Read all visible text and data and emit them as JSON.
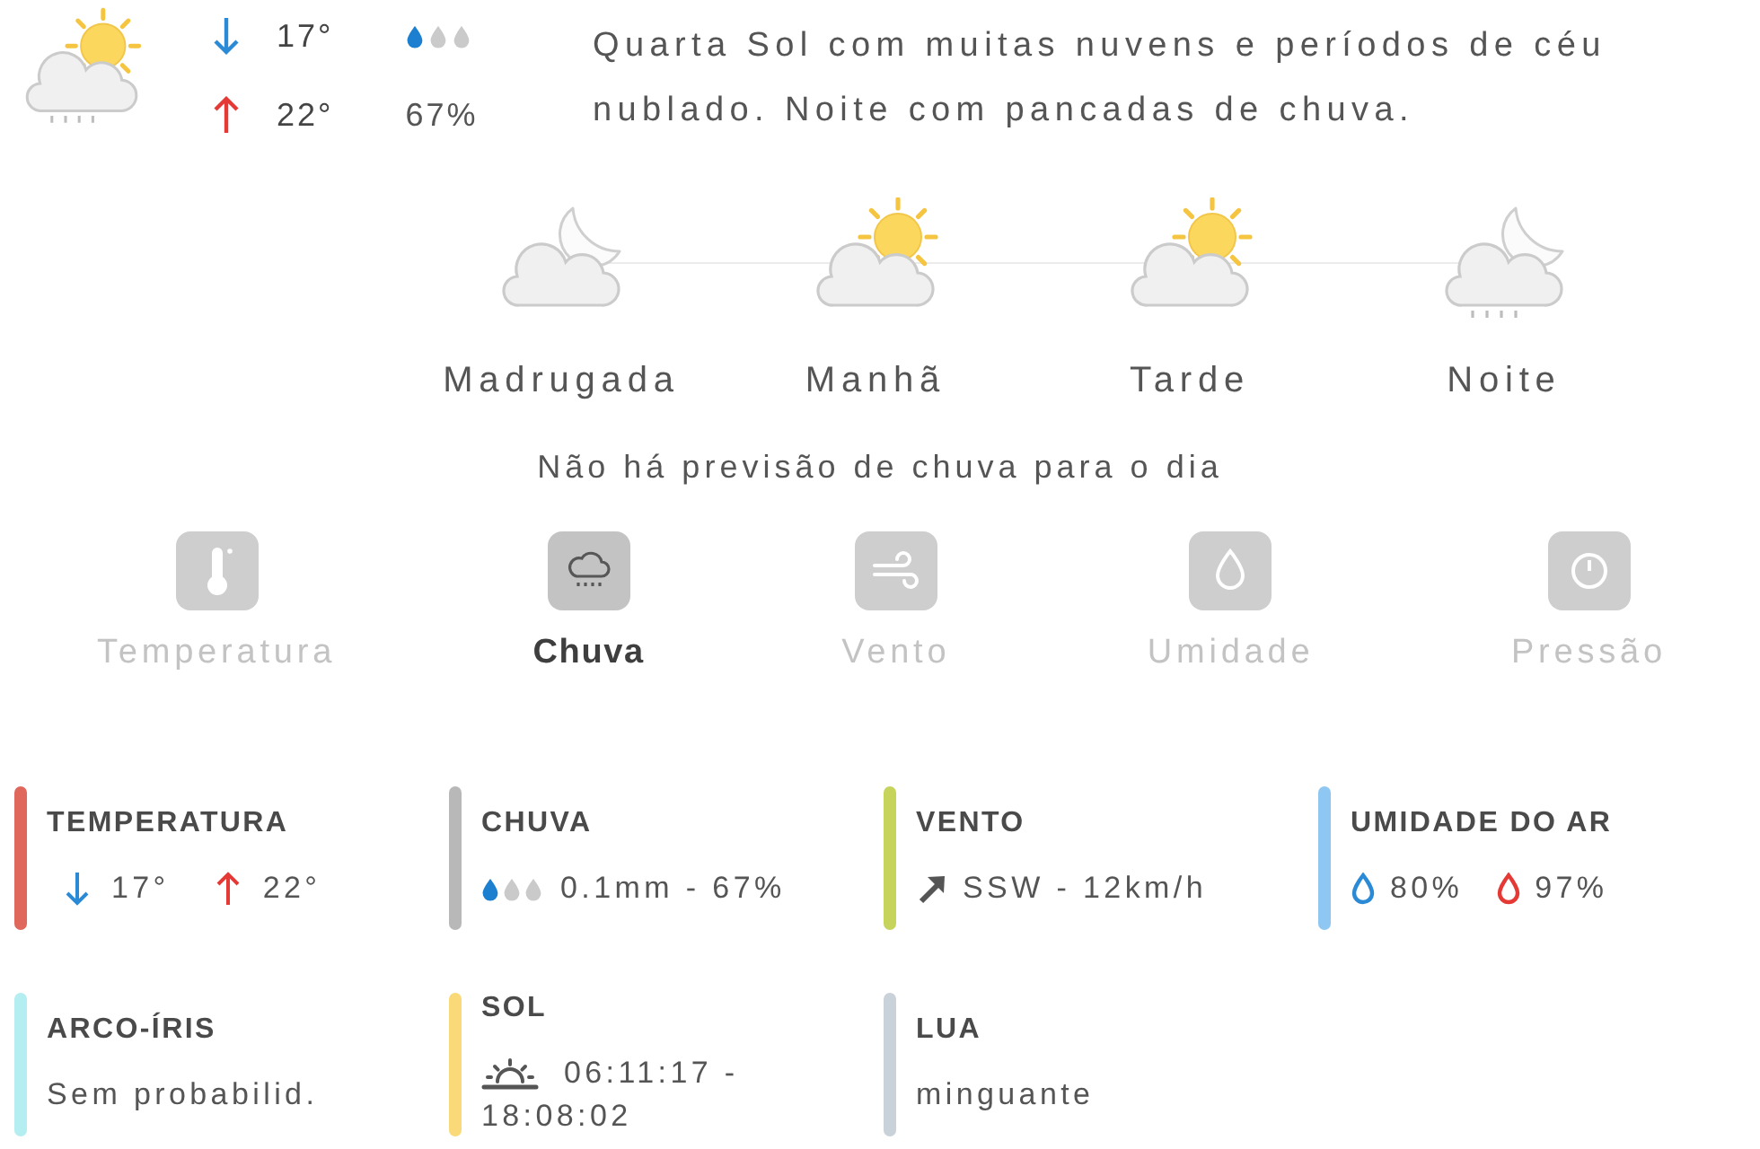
{
  "summary": {
    "kind": "sun-cloud-rain",
    "min": "17°",
    "max": "22°",
    "stars": 1,
    "rain_chance": "67%",
    "description": "Quarta Sol com muitas nuvens e períodos de céu nublado. Noite com pancadas de chuva."
  },
  "periods": [
    {
      "kind": "moon-cloud",
      "label": "Madrugada"
    },
    {
      "kind": "sun-cloud",
      "label": "Manhã"
    },
    {
      "kind": "sun-cloud",
      "label": "Tarde"
    },
    {
      "kind": "moon-cloud-rain",
      "label": "Noite"
    }
  ],
  "rain_note": "Não há previsão de chuva para o dia",
  "tabs": [
    {
      "kind": "temperature",
      "label": "Temperatura",
      "selected": false
    },
    {
      "kind": "rain",
      "label": "Chuva",
      "selected": true
    },
    {
      "kind": "wind",
      "label": "Vento",
      "selected": false
    },
    {
      "kind": "humidity",
      "label": "Umidade",
      "selected": false
    },
    {
      "kind": "pressure",
      "label": "Pressão",
      "selected": false
    }
  ],
  "cards": [
    {
      "kind": "temperature",
      "title": "TEMPERATURA",
      "color": "#e0675c",
      "min": "17°",
      "max": "22°"
    },
    {
      "kind": "rain",
      "title": "CHUVA",
      "color": "#b8b8b8",
      "stars": 1,
      "value": "0.1mm - 67%"
    },
    {
      "kind": "wind",
      "title": "VENTO",
      "color": "#c6d45c",
      "value": "SSW - 12km/h"
    },
    {
      "kind": "humidity",
      "title": "UMIDADE DO AR",
      "color": "#8ec8f2",
      "min": "80%",
      "max": "97%"
    },
    {
      "kind": "text",
      "title": "ARCO-ÍRIS",
      "color": "#b4eef1",
      "value": "Sem probabilid."
    },
    {
      "kind": "sun",
      "title": "SOL",
      "color": "#f9d978",
      "value_lines": [
        "06:11:17 -",
        "18:08:02"
      ]
    },
    {
      "kind": "text",
      "title": "LUA",
      "color": "#c9d1d9",
      "value": "minguante"
    }
  ]
}
